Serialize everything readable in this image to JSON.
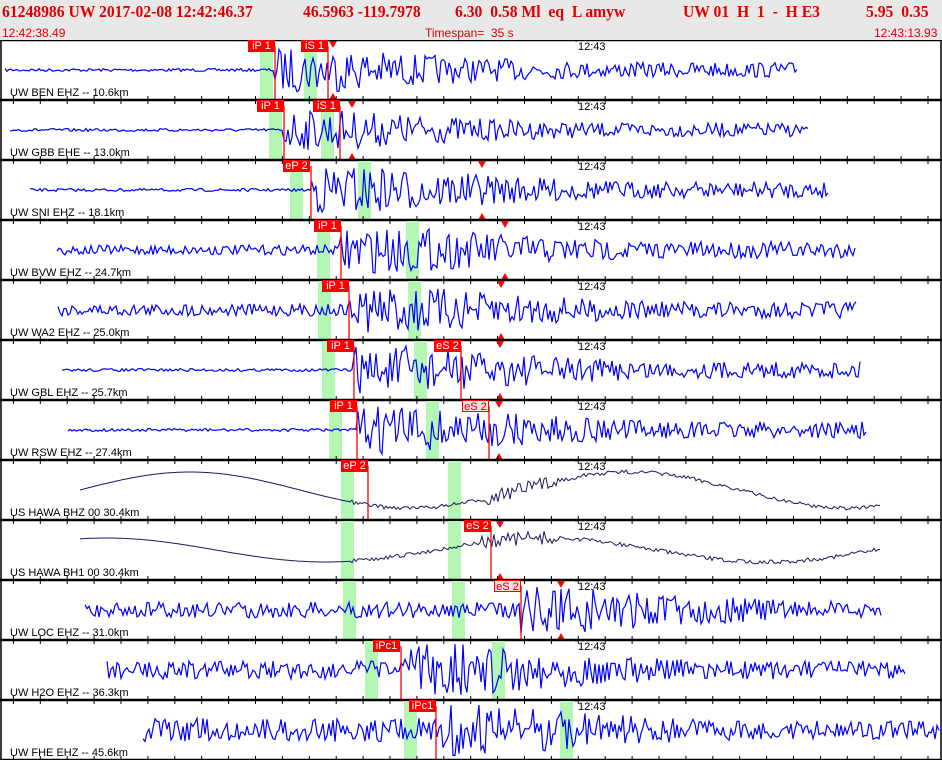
{
  "header": {
    "event": "61248986 UW 2017-02-08 12:42:46.37",
    "location": "46.5963 -119.7978",
    "magnitude": "6.30  0.58 Ml  eq  L amyw",
    "source": "UW 01  H  1  -  H E3",
    "errors": "5.95  0.35",
    "start_time": "12:42:38.49",
    "timespan": "Timespan=  35 s",
    "end_time": "12:43:13.93"
  },
  "minute_mark": "12:43",
  "colors": {
    "trace": "#0000ff",
    "long_period": "#1a1a5a",
    "pick": "#ff0000",
    "window": "#b3f7b3"
  },
  "channels": [
    {
      "label": "UW BEN EHZ -- 10.6km",
      "picks": [
        "iP 1",
        "iS 1"
      ]
    },
    {
      "label": "UW GBB EHE -- 13.0km",
      "picks": [
        "iP 1",
        "iS 1"
      ]
    },
    {
      "label": "UW SNI EHZ -- 18.1km",
      "picks": [
        "eP 2"
      ]
    },
    {
      "label": "UW BVW EHZ -- 24.7km",
      "picks": [
        "iP 1"
      ]
    },
    {
      "label": "UW WA2 EHZ -- 25.0km",
      "picks": [
        "iP 1"
      ]
    },
    {
      "label": "UW GBL EHZ -- 25.7km",
      "picks": [
        "iP 1",
        "eS 2"
      ]
    },
    {
      "label": "UW RSW EHZ -- 27.4km",
      "picks": [
        "iP 1",
        "eS 2"
      ]
    },
    {
      "label": "US HAWA BHZ 00 30.4km",
      "picks": [
        "eP 2"
      ]
    },
    {
      "label": "US HAWA BH1 00 30.4km",
      "picks": [
        "eS 2"
      ]
    },
    {
      "label": "UW LOC EHZ -- 31.0km",
      "picks": [
        "eS 2"
      ]
    },
    {
      "label": "UW H2O EHZ -- 36.3km",
      "picks": [
        "iPc1"
      ]
    },
    {
      "label": "UW FHE EHZ -- 45.6km",
      "picks": [
        "iPc1"
      ]
    }
  ]
}
